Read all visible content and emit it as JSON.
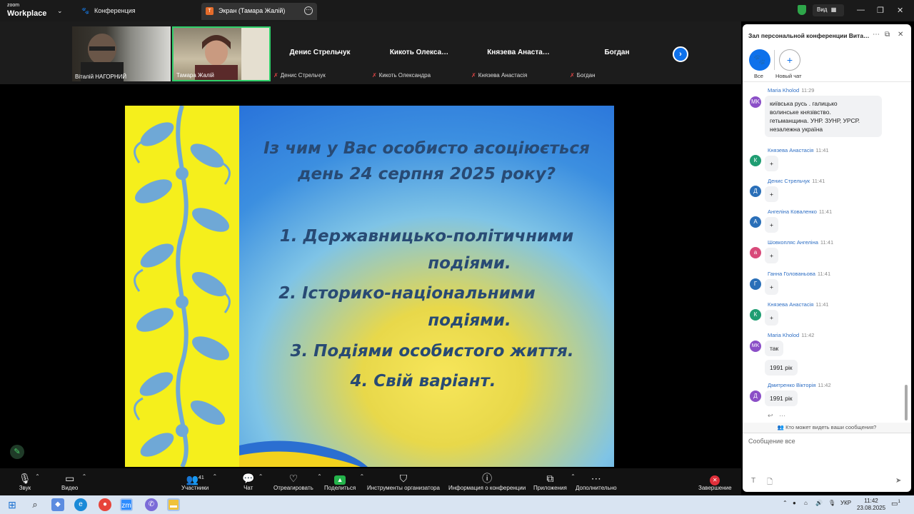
{
  "app": {
    "logo_small": "zoom",
    "logo_big": "Workplace",
    "meeting_tab": "Конференция",
    "screen_tab": "Экран (Тамара Жалій)",
    "view_label": "Вид"
  },
  "participants": {
    "video": [
      {
        "name": "Віталій НАГОРНИЙ"
      },
      {
        "name": "Тамара Жалій"
      }
    ],
    "tiles": [
      {
        "display": "Денис Стрельчук",
        "label": "Денис Стрельчук"
      },
      {
        "display": "Кикоть  Олекса…",
        "label": "Кикоть Олександра"
      },
      {
        "display": "Князева  Анаста…",
        "label": "Князева Анастасія"
      },
      {
        "display": "Богдан",
        "label": "Богдан"
      }
    ]
  },
  "slide": {
    "title_line1": "Із чим у Вас особисто асоціюється",
    "title_line2": "день 24 серпня 2025 року?",
    "item1_line1": "1.  Державницько-політичними",
    "item1_line2": "подіями.",
    "item2_line1": "2.  Історико-національними",
    "item2_line2": "подіями.",
    "item3": "3.  Подіями особистого життя.",
    "item4": "4.  Свій варіант."
  },
  "toolbar": {
    "audio": "Звук",
    "video": "Видео",
    "participants": "Участники",
    "participants_count": "41",
    "chat": "Чат",
    "react": "Отреагировать",
    "share": "Поделиться",
    "host_tools": "Инструменты организатора",
    "meeting_info": "Информация о конференции",
    "apps": "Приложения",
    "more": "Дополнительно",
    "end": "Завершение"
  },
  "chat": {
    "title": "Зал персональной конференции Вита…",
    "channel_all": "Все",
    "channel_new": "Новый чат",
    "messages": [
      {
        "initials": "MK",
        "color": "#8b4fc7",
        "sender": "Maria Kholod",
        "time": "11:29",
        "lines": [
          "київська русь . галицько",
          "волинське князівство.",
          "гетьманщина. УНР. ЗУНР, УРСР.",
          "незалежна україна"
        ]
      },
      {
        "initials": "К",
        "color": "#1f9d72",
        "sender": "Князева Анастасія",
        "time": "11:41",
        "lines": [
          "+"
        ]
      },
      {
        "initials": "Д",
        "color": "#2a6fb8",
        "sender": "Денис Стрельчук",
        "time": "11:41",
        "lines": [
          "+"
        ]
      },
      {
        "initials": "А",
        "color": "#2a6fb8",
        "sender": "Ангеліна Коваленко",
        "time": "11:41",
        "lines": [
          "+"
        ]
      },
      {
        "initials": "а",
        "color": "#d84a7a",
        "sender": "Шовкопляс Ангеліна",
        "time": "11:41",
        "lines": [
          "+"
        ]
      },
      {
        "initials": "Г",
        "color": "#2a6fb8",
        "sender": "Ганна Голованьова",
        "time": "11:41",
        "lines": [
          "+"
        ]
      },
      {
        "initials": "К",
        "color": "#1f9d72",
        "sender": "Князева Анастасія",
        "time": "11:41",
        "lines": [
          "+"
        ]
      },
      {
        "initials": "MK",
        "color": "#8b4fc7",
        "sender": "Maria Kholod",
        "time": "11:42",
        "lines": [
          "так"
        ]
      },
      {
        "initials": "",
        "color": "",
        "sender": "",
        "time": "",
        "lines": [
          "1991 рік"
        ]
      },
      {
        "initials": "Д",
        "color": "#8b4fc7",
        "sender": "Дмитренко Вікторія",
        "time": "11:42",
        "lines": [
          "1991 рік"
        ]
      }
    ],
    "who_can_see": "Кто может видеть ваши сообщения?",
    "input_placeholder": "Сообщение все"
  },
  "taskbar": {
    "lang": "УКР",
    "time": "11:42",
    "date": "23.08.2025",
    "notif_count": "1"
  }
}
